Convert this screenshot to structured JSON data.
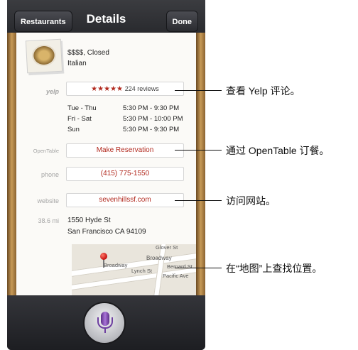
{
  "navbar": {
    "back_label": "Restaurants",
    "title": "Details",
    "done_label": "Done"
  },
  "restaurant": {
    "price_and_status": "$$$$, Closed",
    "cuisine": "Italian"
  },
  "yelp": {
    "label": "yelp",
    "stars": "★★★★★",
    "reviews": "224 reviews"
  },
  "hours": [
    {
      "days": "Tue - Thu",
      "time": "5:30 PM - 9:30 PM"
    },
    {
      "days": "Fri - Sat",
      "time": "5:30 PM - 10:00 PM"
    },
    {
      "days": "Sun",
      "time": "5:30 PM - 9:30 PM"
    }
  ],
  "reservation": {
    "label": "OpenTable",
    "button": "Make Reservation"
  },
  "phone": {
    "label": "phone",
    "value": "(415) 775-1550"
  },
  "website": {
    "label": "website",
    "value": "sevenhillssf.com"
  },
  "address": {
    "distance": "38.6 mi",
    "line1": "1550 Hyde St",
    "line2": "San Francisco CA 94109"
  },
  "map": {
    "streets": [
      "Glover St",
      "Broadway",
      "Broadway",
      "Bernard St",
      "Lynch St",
      "Pacific Ave"
    ]
  },
  "callouts": [
    "查看 Yelp 评论。",
    "通过 OpenTable 订餐。",
    "访问网站。",
    "在“地图”上查找位置。"
  ],
  "colors": {
    "accent_red": "#b22a1f",
    "nav_dark": "#2b2c30",
    "siri_purple": "#6d3ea0"
  }
}
